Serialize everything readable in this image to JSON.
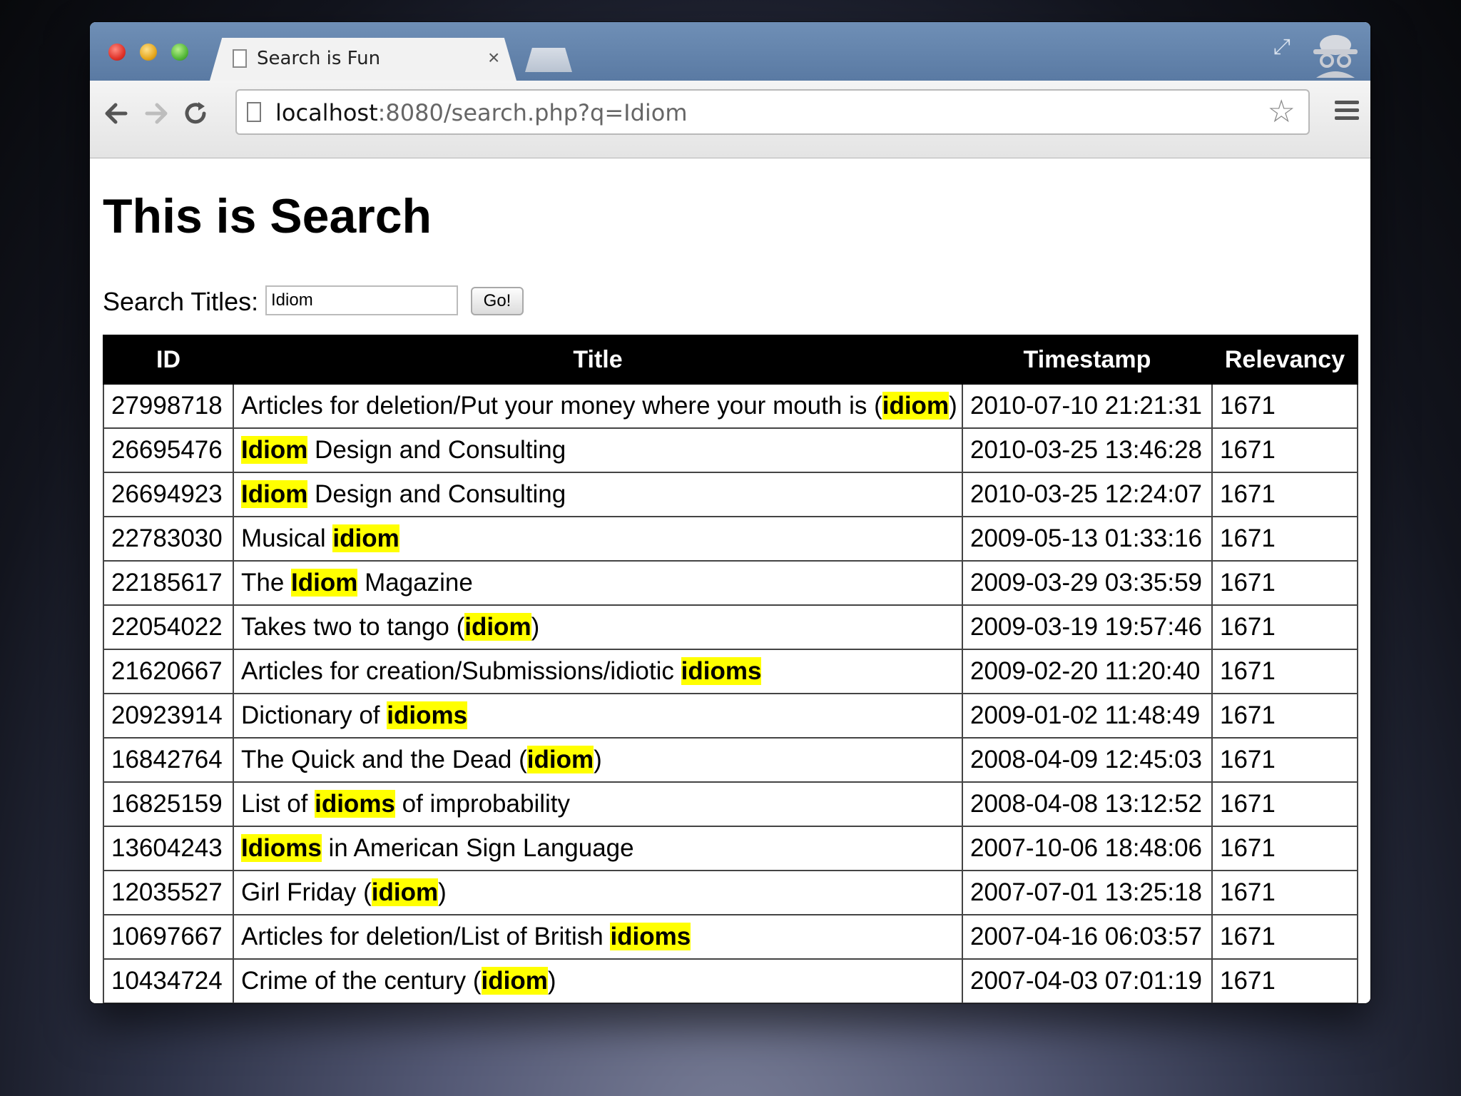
{
  "browser": {
    "tab_title": "Search is Fun",
    "tab_close": "×",
    "url_host": "localhost",
    "url_rest": ":8080/search.php?q=Idiom",
    "fullscreen_glyph": "⤢",
    "star_glyph": "☆"
  },
  "page": {
    "title": "This is Search",
    "search_label": "Search Titles:",
    "search_value": "Idiom",
    "go_label": "Go!"
  },
  "table": {
    "headers": [
      "ID",
      "Title",
      "Timestamp",
      "Relevancy"
    ],
    "rows": [
      {
        "id": "27998718",
        "title": [
          [
            "Articles for deletion/Put your money where your mouth is (",
            false
          ],
          [
            "idiom",
            true
          ],
          [
            ")",
            false
          ]
        ],
        "timestamp": "2010-07-10 21:21:31",
        "relevancy": "1671"
      },
      {
        "id": "26695476",
        "title": [
          [
            "Idiom",
            true
          ],
          [
            " Design and Consulting",
            false
          ]
        ],
        "timestamp": "2010-03-25 13:46:28",
        "relevancy": "1671"
      },
      {
        "id": "26694923",
        "title": [
          [
            "Idiom",
            true
          ],
          [
            " Design and Consulting",
            false
          ]
        ],
        "timestamp": "2010-03-25 12:24:07",
        "relevancy": "1671"
      },
      {
        "id": "22783030",
        "title": [
          [
            "Musical ",
            false
          ],
          [
            "idiom",
            true
          ]
        ],
        "timestamp": "2009-05-13 01:33:16",
        "relevancy": "1671"
      },
      {
        "id": "22185617",
        "title": [
          [
            "The ",
            false
          ],
          [
            "Idiom",
            true
          ],
          [
            " Magazine",
            false
          ]
        ],
        "timestamp": "2009-03-29 03:35:59",
        "relevancy": "1671"
      },
      {
        "id": "22054022",
        "title": [
          [
            "Takes two to tango (",
            false
          ],
          [
            "idiom",
            true
          ],
          [
            ")",
            false
          ]
        ],
        "timestamp": "2009-03-19 19:57:46",
        "relevancy": "1671"
      },
      {
        "id": "21620667",
        "title": [
          [
            "Articles for creation/Submissions/idiotic ",
            false
          ],
          [
            "idioms",
            true
          ]
        ],
        "timestamp": "2009-02-20 11:20:40",
        "relevancy": "1671"
      },
      {
        "id": "20923914",
        "title": [
          [
            "Dictionary of ",
            false
          ],
          [
            "idioms",
            true
          ]
        ],
        "timestamp": "2009-01-02 11:48:49",
        "relevancy": "1671"
      },
      {
        "id": "16842764",
        "title": [
          [
            "The Quick and the Dead (",
            false
          ],
          [
            "idiom",
            true
          ],
          [
            ")",
            false
          ]
        ],
        "timestamp": "2008-04-09 12:45:03",
        "relevancy": "1671"
      },
      {
        "id": "16825159",
        "title": [
          [
            "List of ",
            false
          ],
          [
            "idioms",
            true
          ],
          [
            " of improbability",
            false
          ]
        ],
        "timestamp": "2008-04-08 13:12:52",
        "relevancy": "1671"
      },
      {
        "id": "13604243",
        "title": [
          [
            "Idioms",
            true
          ],
          [
            " in American Sign Language",
            false
          ]
        ],
        "timestamp": "2007-10-06 18:48:06",
        "relevancy": "1671"
      },
      {
        "id": "12035527",
        "title": [
          [
            "Girl Friday (",
            false
          ],
          [
            "idiom",
            true
          ],
          [
            ")",
            false
          ]
        ],
        "timestamp": "2007-07-01 13:25:18",
        "relevancy": "1671"
      },
      {
        "id": "10697667",
        "title": [
          [
            "Articles for deletion/List of British ",
            false
          ],
          [
            "idioms",
            true
          ]
        ],
        "timestamp": "2007-04-16 06:03:57",
        "relevancy": "1671"
      },
      {
        "id": "10434724",
        "title": [
          [
            "Crime of the century (",
            false
          ],
          [
            "idiom",
            true
          ],
          [
            ")",
            false
          ]
        ],
        "timestamp": "2007-04-03 07:01:19",
        "relevancy": "1671"
      }
    ]
  },
  "colors": {
    "highlight": "#ffff00",
    "header_bg": "#000000"
  }
}
